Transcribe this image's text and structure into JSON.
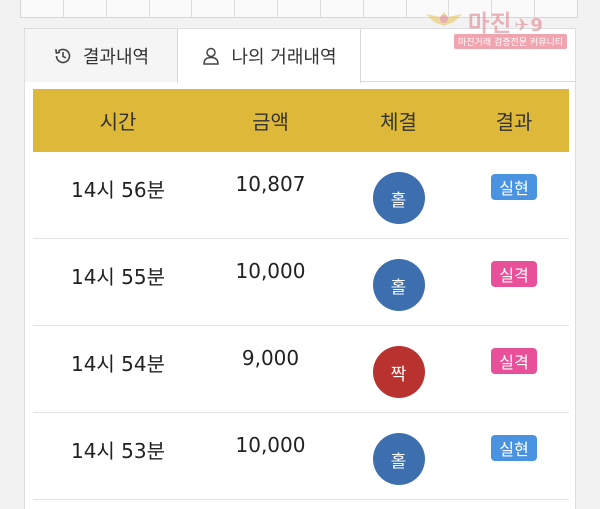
{
  "watermark": {
    "title": "마진",
    "suffix": "✈9",
    "subtitle": "마진거래 검증전문 커뮤니티"
  },
  "tabs": [
    {
      "label": "결과내역",
      "icon": "history-icon",
      "active": false
    },
    {
      "label": "나의 거래내역",
      "icon": "user-icon",
      "active": true
    }
  ],
  "table": {
    "headers": [
      "시간",
      "금액",
      "체결",
      "결과"
    ],
    "rows": [
      {
        "time": "14시 56분",
        "amount": "10,807",
        "pick": "홀",
        "pick_color": "#3d6fae",
        "result": "실현",
        "result_color": "#4a93e0"
      },
      {
        "time": "14시 55분",
        "amount": "10,000",
        "pick": "홀",
        "pick_color": "#3d6fae",
        "result": "실격",
        "result_color": "#e8519a"
      },
      {
        "time": "14시 54분",
        "amount": "9,000",
        "pick": "짝",
        "pick_color": "#b83330",
        "result": "실격",
        "result_color": "#e8519a"
      },
      {
        "time": "14시 53분",
        "amount": "10,000",
        "pick": "홀",
        "pick_color": "#3d6fae",
        "result": "실현",
        "result_color": "#4a93e0"
      }
    ]
  },
  "colors": {
    "header_bg": "#deb838"
  }
}
